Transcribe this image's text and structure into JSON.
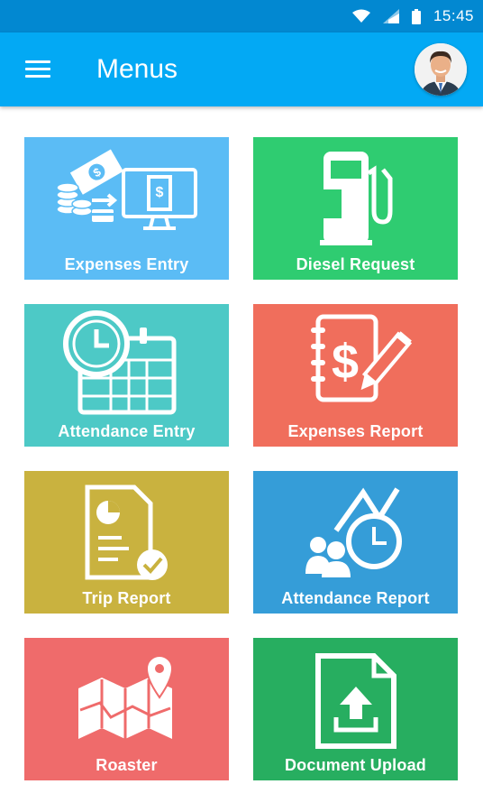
{
  "status_bar": {
    "time": "15:45",
    "icons": [
      "wifi-icon",
      "signal-icon",
      "battery-icon"
    ]
  },
  "app_bar": {
    "title": "Menus",
    "menu_icon": "hamburger-menu-icon",
    "color": "#03a9f4"
  },
  "menu": {
    "tiles": [
      {
        "label": "Expenses Entry",
        "icon": "expenses-entry-icon",
        "color": "#5bbcf5"
      },
      {
        "label": "Diesel Request",
        "icon": "fuel-pump-icon",
        "color": "#2fcc71"
      },
      {
        "label": "Attendance Entry",
        "icon": "clock-calendar-icon",
        "color": "#4dc9c6"
      },
      {
        "label": "Expenses Report",
        "icon": "dollar-notebook-icon",
        "color": "#f06e5c"
      },
      {
        "label": "Trip Report",
        "icon": "report-chart-icon",
        "color": "#c9b23f"
      },
      {
        "label": "Attendance Report",
        "icon": "users-clock-chart-icon",
        "color": "#359dd8"
      },
      {
        "label": "Roaster",
        "icon": "map-pin-icon",
        "color": "#ef6b6b"
      },
      {
        "label": "Document Upload",
        "icon": "document-upload-icon",
        "color": "#27ae60"
      }
    ]
  }
}
